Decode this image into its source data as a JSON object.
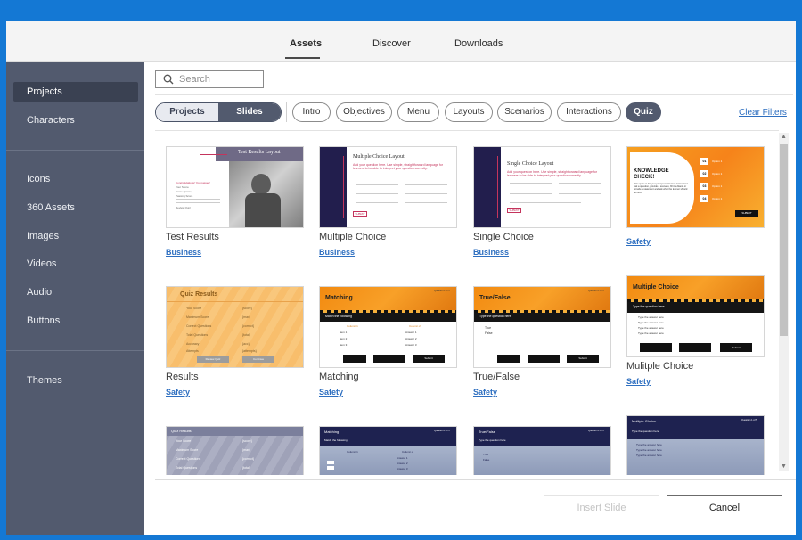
{
  "topnav": {
    "tabs": [
      {
        "label": "Assets"
      },
      {
        "label": "Discover"
      },
      {
        "label": "Downloads"
      }
    ]
  },
  "sidebar": {
    "items": [
      {
        "label": "Projects"
      },
      {
        "label": "Characters"
      },
      {
        "label": "Icons"
      },
      {
        "label": "360 Assets"
      },
      {
        "label": "Images"
      },
      {
        "label": "Videos"
      },
      {
        "label": "Audio"
      },
      {
        "label": "Buttons"
      },
      {
        "label": "Themes"
      }
    ]
  },
  "search": {
    "placeholder": "Search",
    "icon": "search-icon"
  },
  "toggle": {
    "left": "Projects",
    "right": "Slides"
  },
  "filters": [
    "Intro",
    "Objectives",
    "Menu",
    "Layouts",
    "Scenarios",
    "Interactions",
    "Quiz"
  ],
  "clear_filters": "Clear Filters",
  "cards": [
    {
      "title": "Test Results",
      "tag": "Business",
      "thumb": {
        "heading": "Test Results Layout",
        "lines": [
          "Congratulations! You passed!",
          "Your Score",
          "Score: {score}",
          "Passing Score",
          "Review Quiz"
        ]
      }
    },
    {
      "title": "Multiple Choice",
      "tag": "Business",
      "thumb": {
        "heading": "Multiple Choice Layout",
        "intro": "Add your question here. Use simple, straightforward language for learners to be able to interpret your question correctly.",
        "button": "SUBMIT"
      }
    },
    {
      "title": "Single Choice",
      "tag": "Business",
      "thumb": {
        "heading": "Single Choice Layout",
        "intro": "Add your question here. Use simple, straightforward language for learners to be able to interpret your question correctly.",
        "button": "SUBMIT"
      }
    },
    {
      "title": "",
      "tag": "Safety",
      "thumb": {
        "heading": "KNOWLEDGE CHECK!",
        "intro": "This space is for your prompt and learner instructions. Ask a question, provide a scenario, fill in a blank, or provide a statement and ask what the learner should do next.",
        "options": [
          "01",
          "02",
          "03",
          "04"
        ],
        "option_label": "Option 1",
        "button": "SUBMIT"
      }
    },
    {
      "title": "Results",
      "tag": "Safety",
      "thumb": {
        "heading": "Quiz Results",
        "rows": [
          [
            "Your Score",
            "{score}"
          ],
          [
            "Maximum Score",
            "{max}"
          ],
          [
            "Correct Questions",
            "{correct}"
          ],
          [
            "Total Questions",
            "{total}"
          ],
          [
            "Accuracy",
            "{acc}"
          ],
          [
            "Attempts",
            "{attempts}"
          ]
        ],
        "buttons": [
          "Review Quiz",
          "Continue"
        ]
      }
    },
    {
      "title": "Matching",
      "tag": "Safety",
      "thumb": {
        "heading": "Matching",
        "counter": "Question 1 of 5",
        "prompt": "Match the following",
        "col_a": "Column 1",
        "col_b": "Column 2",
        "items": [
          "Item 1",
          "Item 2",
          "Item 3"
        ],
        "answers": [
          "Answer 1",
          "Answer 2",
          "Answer 3"
        ],
        "button": "Submit"
      }
    },
    {
      "title": "True/False",
      "tag": "Safety",
      "thumb": {
        "heading": "True/False",
        "counter": "Question 1 of 5",
        "prompt": "Type the question here",
        "options": [
          "True",
          "False"
        ],
        "button": "Submit"
      }
    },
    {
      "title": "Mulitple Choice",
      "tag": "Safety",
      "thumb": {
        "heading": "Multiple Choice",
        "prompt": "Type the question here",
        "options": [
          "Type the answer here",
          "Type the answer here",
          "Type the answer here",
          "Type the answer here"
        ],
        "button": "Submit"
      }
    },
    {
      "title": "",
      "tag": "",
      "thumb": {
        "heading": "Quiz Results",
        "rows": [
          [
            "Your Score",
            "{score}"
          ],
          [
            "Maximum Score",
            "{max}"
          ],
          [
            "Correct Questions",
            "{correct}"
          ],
          [
            "Total Questions",
            "{total}"
          ]
        ]
      }
    },
    {
      "title": "",
      "tag": "",
      "thumb": {
        "heading": "Matching",
        "counter": "Question 1 of 5",
        "prompt": "Match the following",
        "col_a": "Column 1",
        "col_b": "Column 2",
        "answers": [
          "Answer 1",
          "Answer 2",
          "Answer 3"
        ]
      }
    },
    {
      "title": "",
      "tag": "",
      "thumb": {
        "heading": "True/False",
        "counter": "Question 1 of 5",
        "prompt": "Type the question here",
        "options": [
          "True",
          "False"
        ]
      }
    },
    {
      "title": "",
      "tag": "",
      "thumb": {
        "heading": "Multiple Choice",
        "counter": "Question 1 of 5",
        "prompt": "Type the question here",
        "options": [
          "Type the answer here",
          "Type the answer here",
          "Type the answer here"
        ]
      }
    }
  ],
  "footer": {
    "insert": "Insert Slide",
    "cancel": "Cancel"
  },
  "colors": {
    "accent": "#525a6e",
    "link": "#2e6fc0",
    "frame": "#1478d4",
    "orange": "#f39a1c"
  }
}
